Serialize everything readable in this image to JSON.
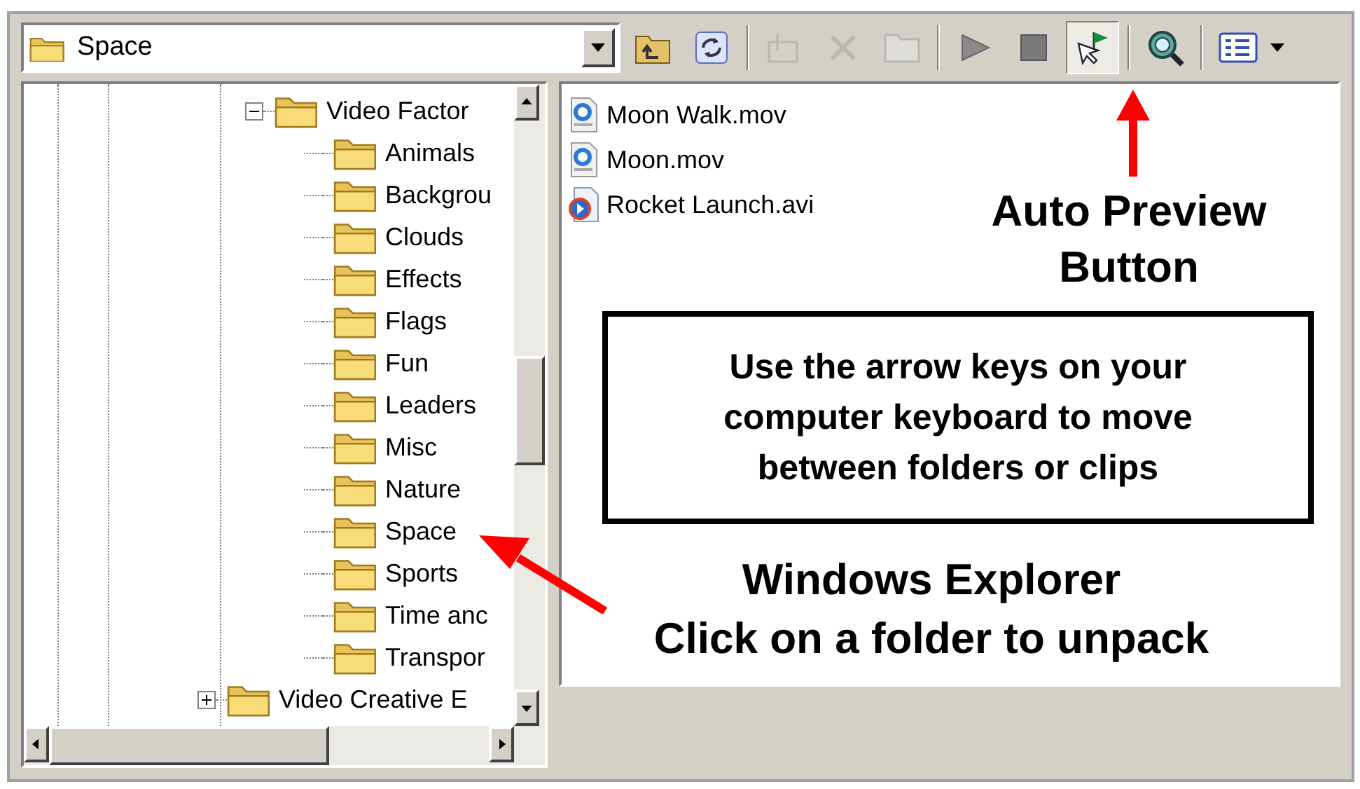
{
  "path_box": {
    "value": "Space"
  },
  "toolbar": [
    {
      "kind": "up-folder",
      "disabled": false,
      "pressed": false
    },
    {
      "kind": "refresh",
      "disabled": false,
      "pressed": false
    },
    {
      "kind": "sep"
    },
    {
      "kind": "new-folder",
      "disabled": true,
      "pressed": false
    },
    {
      "kind": "delete",
      "disabled": true,
      "pressed": false
    },
    {
      "kind": "folder",
      "disabled": true,
      "pressed": false
    },
    {
      "kind": "sep"
    },
    {
      "kind": "play",
      "disabled": false,
      "pressed": false
    },
    {
      "kind": "stop",
      "disabled": false,
      "pressed": false
    },
    {
      "kind": "auto-preview",
      "disabled": false,
      "pressed": true
    },
    {
      "kind": "sep"
    },
    {
      "kind": "search",
      "disabled": false,
      "pressed": false
    },
    {
      "kind": "sep"
    },
    {
      "kind": "view",
      "disabled": false,
      "pressed": false
    }
  ],
  "tree": [
    {
      "label": "Video Factor",
      "expanded": true,
      "children": [
        {
          "label": "Animals"
        },
        {
          "label": "Backgrou"
        },
        {
          "label": "Clouds"
        },
        {
          "label": "Effects"
        },
        {
          "label": "Flags"
        },
        {
          "label": "Fun"
        },
        {
          "label": "Leaders"
        },
        {
          "label": "Misc"
        },
        {
          "label": "Nature"
        },
        {
          "label": "Space"
        },
        {
          "label": "Sports"
        },
        {
          "label": "Time anc"
        },
        {
          "label": "Transpor"
        }
      ]
    },
    {
      "label": "Video Creative E",
      "expanded": false
    }
  ],
  "files": [
    {
      "name": "Moon Walk.mov",
      "kind": "mov"
    },
    {
      "name": "Moon.mov",
      "kind": "mov"
    },
    {
      "name": "Rocket Launch.avi",
      "kind": "avi"
    }
  ],
  "annotations": [
    {
      "kind": "label",
      "text": "Auto Preview\nButton"
    },
    {
      "kind": "box",
      "text": "Use the arrow keys on your\ncomputer keyboard to move\nbetween folders or clips"
    },
    {
      "kind": "label-left",
      "text": "Windows Explorer\nClick on a folder to unpack"
    }
  ]
}
